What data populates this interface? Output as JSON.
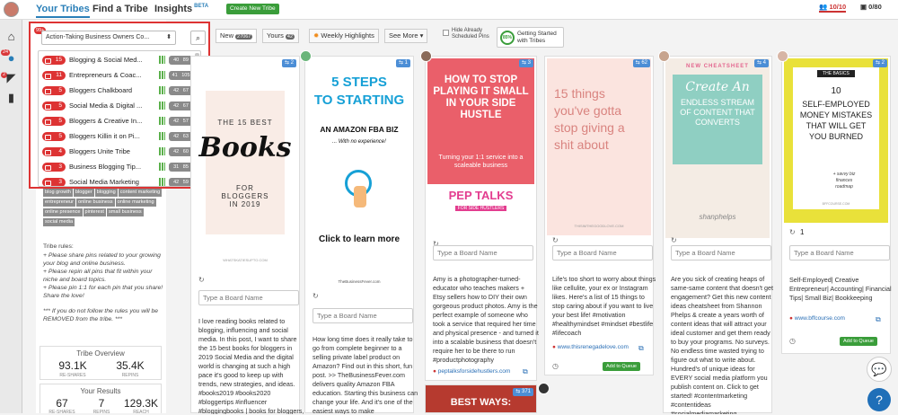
{
  "topnav": {
    "tabs": [
      {
        "label": "Your Tribes"
      },
      {
        "label": "Find a Tribe"
      },
      {
        "label": "Insights"
      }
    ],
    "beta": "BETA",
    "new_tribe": "Create New Tribe",
    "count1": "10/10",
    "count2": "0/80"
  },
  "sidebar_badges": {
    "b1": "99+",
    "b2": "24",
    "b3": "2"
  },
  "dropdown": {
    "badge": "99+",
    "selected": "Action-Taking Business Owners Co...",
    "items": [
      {
        "count": "15",
        "name": "Blogging & Social Med...",
        "stats": "40 89"
      },
      {
        "count": "11",
        "name": "Entrepreneurs & Coac...",
        "stats": "41 105"
      },
      {
        "count": "5",
        "name": "Bloggers Chalkboard",
        "stats": "42 67"
      },
      {
        "count": "5",
        "name": "Social Media & Digital ...",
        "stats": "42 67"
      },
      {
        "count": "5",
        "name": "Bloggers & Creative In...",
        "stats": "42 57"
      },
      {
        "count": "5",
        "name": "Bloggers Killin it on Pi...",
        "stats": "42 63"
      },
      {
        "count": "4",
        "name": "Bloggers Unite Tribe",
        "stats": "42 60"
      },
      {
        "count": "3",
        "name": "Business Blogging Tip...",
        "stats": "31 85"
      },
      {
        "count": "3",
        "name": "Social Media Marketing",
        "stats": "42 59"
      }
    ]
  },
  "tags": [
    "blog growth",
    "blogger",
    "blogging",
    "content marketing",
    "entrepreneur",
    "online business",
    "online marketing",
    "online presence",
    "pinterest",
    "small business",
    "social media"
  ],
  "rules": {
    "title": "Tribe rules:",
    "lines": [
      "+ Please share pins related to your growing your blog and online business.",
      "+ Please repin all pins that fit within your niche and board topics.",
      "+ Please pin 1:1 for each pin that you share! Share the love!"
    ],
    "note": "*** If you do not follow the rules you will be REMOVED from the tribe. ***"
  },
  "overview": {
    "title": "Tribe Overview",
    "v1": "93.1K",
    "l1": "RE-SHARES",
    "v2": "35.4K",
    "l2": "REPINS"
  },
  "results": {
    "title": "Your Results",
    "v1": "67",
    "l1": "RE-SHARES",
    "v2": "7",
    "l2": "REPINS",
    "v3": "129.3K",
    "l3": "REACH"
  },
  "tabs": {
    "new": "New",
    "new_count": "27067",
    "yours": "Yours",
    "yours_count": "42",
    "weekly": "Weekly Highlights",
    "see_more": "See More",
    "hide": "Hide Already Scheduled Pins",
    "gs_pct": "85%",
    "gs_label": "Getting Started with Tribes"
  },
  "board_placeholder": "Type a Board Name",
  "cards": [
    {
      "rp": "2",
      "img_title": "THE 15 BEST",
      "img_big": "Books",
      "img_sub": "FOR BLOGGERS IN 2019",
      "img_foot": "WHATSKATIESUPTO.COM",
      "desc": "I love reading books related to blogging, influencing and social media. In this post, I want to share the 15 best books for bloggers in 2019 Social Media and the digital world is changing at such a high pace it's good to keep up with trends, new strategies, and ideas. #books2019 #books2020 #bloggertips #influencer #bloggingbooks | books for bloggers,"
    },
    {
      "rp": "1",
      "img_l1": "5 STEPS",
      "img_l2": "TO STARTING",
      "img_l3": "AN AMAZON FBA BIZ",
      "img_l4": "... With no experience!",
      "img_l5": "Click to learn more",
      "img_foot": "TheBusinessFever.com",
      "desc": "How long time does it really take to go from complete beginner to a selling private label product on Amazon? Find out in this short, fun post.   >> TheBusinessFever.com delivers quality Amazon FBA education. Starting this business can change your life. And it's one of the easiest ways to make"
    },
    {
      "rp": "3",
      "img_title": "HOW TO STOP PLAYING IT SMALL IN YOUR SIDE HUSTLE",
      "img_sub": "Turning your 1:1 service into a scaleable business",
      "img_logo": "PEP TALKS",
      "img_logo2": "FOR SIDE HUSTLERS",
      "desc": "Amy is a photographer-turned-educator who teaches makers + Etsy sellers how to DIY their own gorgeous product photos. Amy is the perfect example of someone who took a service that required her time and physical presence - and turned it into a scalable business that doesn't require her to be there to run #productphotography #onlinecoursecreator #onlinebusiness",
      "link": "peptalksforsidehustlers.com",
      "img2": "BEST WAYS:",
      "img2_rp": "371"
    },
    {
      "rp": "62",
      "img_title": "15 things you've gotta stop giving a shit about",
      "img_foot": "THISIMTHEGOODLOVE.COM",
      "desc": "Life's too short to worry about things like cellulite, your ex or Instagram likes. Here's a list of 15 things to stop caring about if you want to live your best life! #motivation #healthymindset #mindset #bestlife #lifecoach",
      "link": "www.thisrenegadelove.com",
      "queue": "Add to Queue"
    },
    {
      "rp": "4",
      "img_tag": "NEW CHEATSHEET",
      "img_title": "Create An",
      "img_sub": "ENDLESS STREAM OF CONTENT THAT CONVERTS",
      "img_sig": "shanphelps",
      "desc": "Are you sick of creating heaps of same-same content that doesn't get engagement? Get this new content ideas cheatsheet from Shannon Phelps & create a years worth of content ideas that will attract your ideal customer and get them ready to buy your programs. No surveys. No endless time wasted trying to figure out what to write about. Hundred's of unique ideas for EVERY social media platform you publish content on. Click to get started! #contentmarketing #contentideas #socialmediamarketing"
    },
    {
      "rp": "2",
      "img_top": "THE BASICS",
      "img_num": "10",
      "img_title": "SELF-EMPLOYED MONEY MISTAKES THAT WILL GET YOU BURNED",
      "img_note": "+ savvy biz finances roadmap",
      "img_foot": "BFFCOURSE.COM",
      "count": "1",
      "desc": "Self-Employed| Creative Entrepreneur| Accounting| Financial Tips| Small Biz| Bookkeeping",
      "link": "www.bffcourse.com",
      "queue": "Add to Queue"
    }
  ]
}
